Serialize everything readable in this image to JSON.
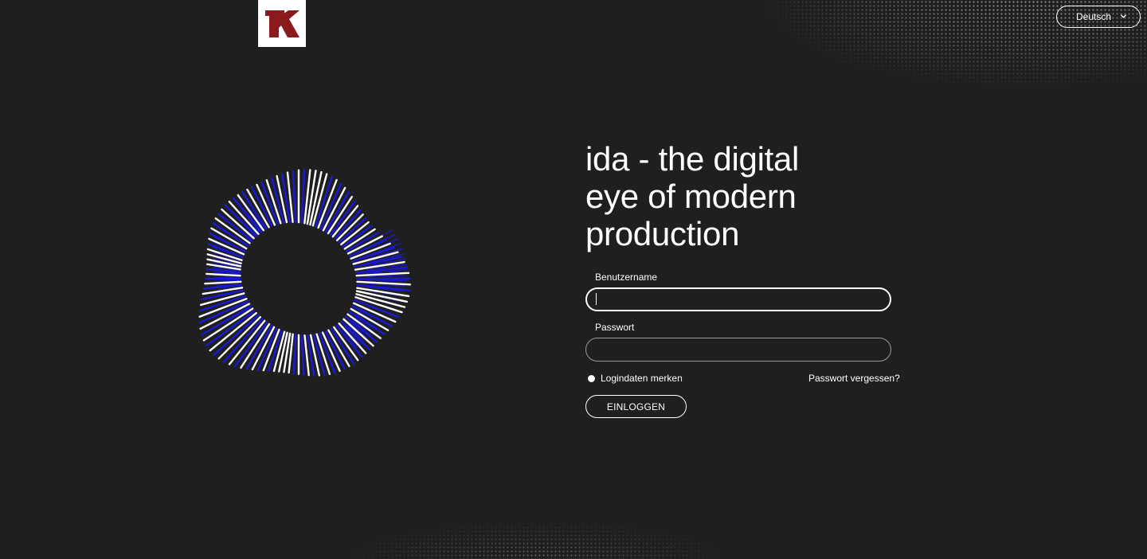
{
  "colors": {
    "background": "#1f1f1f",
    "text": "#ffffff",
    "logo_bg": "#ffffff",
    "logo_mark": "#8b1a1e",
    "ring_blue": "#1a1ad6",
    "ring_white": "#ffffff"
  },
  "logo": {
    "letter": "K",
    "icon": "company-logo"
  },
  "language": {
    "selected": "Deutsch",
    "icon": "chevron-down-icon"
  },
  "hero": {
    "headline_line1": "ida - the digital",
    "headline_line2": "eye of modern",
    "headline_line3": "production",
    "graphic": "radial-eye-ring"
  },
  "form": {
    "username_label": "Benutzername",
    "username_value": "",
    "password_label": "Passwort",
    "password_value": "",
    "remember_label": "Logindaten merken",
    "forgot_link": "Passwort vergessen?",
    "submit_label": "EINLOGGEN"
  }
}
